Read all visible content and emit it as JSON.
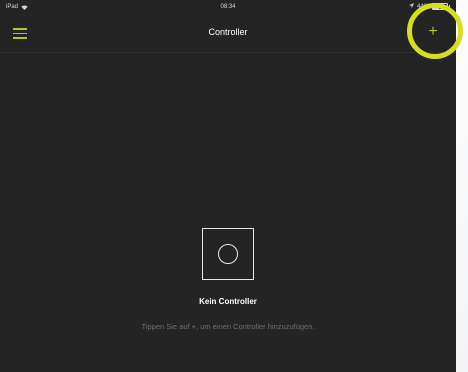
{
  "status_bar": {
    "device": "iPad",
    "time": "08:34",
    "battery": "44%",
    "battery_level": 0.44
  },
  "nav": {
    "title": "Controller",
    "add_label": "+"
  },
  "empty_state": {
    "title": "Kein Controller",
    "hint": "Tippen Sie auf +, um einen Controller hinzuzufügen."
  },
  "colors": {
    "accent": "#b8c426",
    "highlight": "#d7de1e",
    "background": "#242424"
  },
  "icons": {
    "menu": "hamburger-menu-icon",
    "add": "plus-icon",
    "empty": "controller-placeholder-icon",
    "wifi": "wifi-icon",
    "location": "location-arrow-icon",
    "battery": "battery-icon"
  }
}
